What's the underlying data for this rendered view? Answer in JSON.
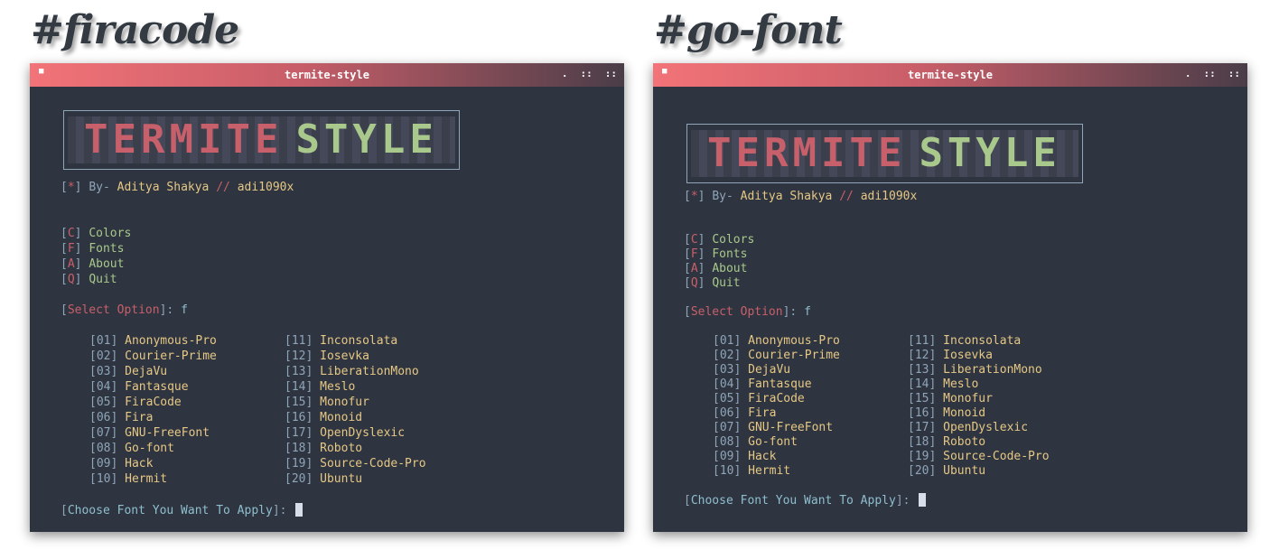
{
  "headings": [
    "#firacode",
    "#go-font"
  ],
  "window": {
    "title": "termite-style",
    "left_glyph": "■",
    "right_glyphs": [
      ".",
      "::",
      "::"
    ]
  },
  "logo": {
    "part1": "TERMITE",
    "part2": "STYLE"
  },
  "byline": {
    "marker": "*",
    "by": "By-",
    "name": "Aditya Shakya",
    "sep": "//",
    "handle": "adi1090x"
  },
  "menu": [
    {
      "key": "C",
      "label": "Colors"
    },
    {
      "key": "F",
      "label": "Fonts"
    },
    {
      "key": "A",
      "label": "About"
    },
    {
      "key": "Q",
      "label": "Quit"
    }
  ],
  "select_prompt": {
    "label": "Select Option",
    "value": "f"
  },
  "fonts": [
    {
      "num": "01",
      "name": "Anonymous-Pro"
    },
    {
      "num": "02",
      "name": "Courier-Prime"
    },
    {
      "num": "03",
      "name": "DejaVu"
    },
    {
      "num": "04",
      "name": "Fantasque"
    },
    {
      "num": "05",
      "name": "FiraCode"
    },
    {
      "num": "06",
      "name": "Fira"
    },
    {
      "num": "07",
      "name": "GNU-FreeFont"
    },
    {
      "num": "08",
      "name": "Go-font"
    },
    {
      "num": "09",
      "name": "Hack"
    },
    {
      "num": "10",
      "name": "Hermit"
    },
    {
      "num": "11",
      "name": "Inconsolata"
    },
    {
      "num": "12",
      "name": "Iosevka"
    },
    {
      "num": "13",
      "name": "LiberationMono"
    },
    {
      "num": "14",
      "name": "Meslo"
    },
    {
      "num": "15",
      "name": "Monofur"
    },
    {
      "num": "16",
      "name": "Monoid"
    },
    {
      "num": "17",
      "name": "OpenDyslexic"
    },
    {
      "num": "18",
      "name": "Roboto"
    },
    {
      "num": "19",
      "name": "Source-Code-Pro"
    },
    {
      "num": "20",
      "name": "Ubuntu"
    }
  ],
  "choose_prompt": "Choose Font You Want To Apply",
  "colors": {
    "bg": "#2e3440",
    "red": "#c7606a",
    "yellow": "#e6c885",
    "green": "#a8c98b",
    "cyan": "#8fbfcf",
    "bracket": "#8fa5b8"
  }
}
